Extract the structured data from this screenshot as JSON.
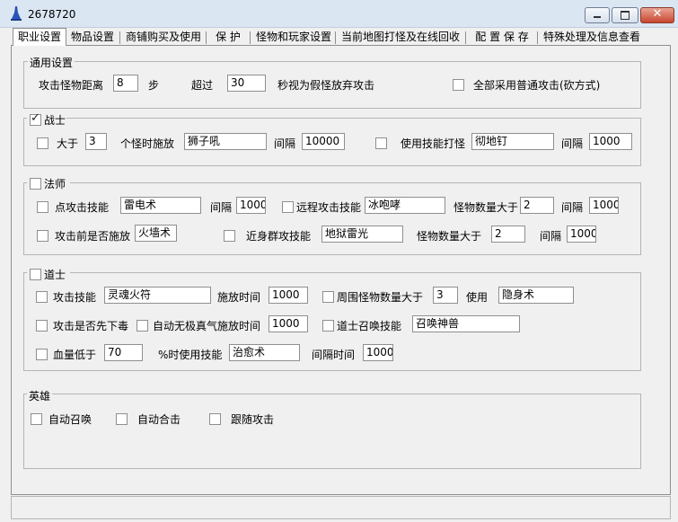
{
  "window": {
    "title": "2678720"
  },
  "tabs": [
    "职业设置",
    "物品设置",
    "商铺购买及使用",
    "保  护",
    "怪物和玩家设置",
    "当前地图打怪及在线回收",
    "配 置 保 存",
    "特殊处理及信息查看"
  ],
  "general": {
    "title": "通用设置",
    "distance_label": "攻击怪物距离",
    "distance_value": "8",
    "step_label": "步",
    "exceed_label": "超过",
    "exceed_value": "30",
    "fake_label": "秒视为假怪放弃攻击",
    "normal_attack_label": "全部采用普通攻击(砍方式)"
  },
  "warrior": {
    "title": "战士",
    "checked": true,
    "gt_label": "大于",
    "gt_value": "3",
    "cast_label": "个怪时施放",
    "skill1": "狮子吼",
    "interval_label": "间隔",
    "interval1": "10000",
    "use_skill_label": "使用技能打怪",
    "skill2": "彻地钉",
    "interval2": "1000"
  },
  "mage": {
    "title": "法师",
    "point_label": "点攻击技能",
    "point_skill": "雷电术",
    "interval_label": "间隔",
    "point_interval": "1000",
    "ranged_label": "远程攻击技能",
    "ranged_skill": "冰咆哮",
    "monster_gt_label": "怪物数量大于",
    "ranged_count": "2",
    "ranged_interval": "1000",
    "pre_cast_label": "攻击前是否施放",
    "pre_cast_skill": "火墙术",
    "melee_label": "近身群攻技能",
    "melee_skill": "地狱雷光",
    "melee_count": "2",
    "melee_interval": "1000"
  },
  "taoist": {
    "title": "道士",
    "attack_label": "攻击技能",
    "attack_skill": "灵魂火符",
    "cast_time_label": "施放时间",
    "attack_time": "1000",
    "around_label": "周围怪物数量大于",
    "around_value": "3",
    "use_label": "使用",
    "around_skill": "隐身术",
    "poison_label": "攻击是否先下毒",
    "auto_label": "自动无极真气施放时间",
    "auto_time": "1000",
    "summon_label": "道士召唤技能",
    "summon_skill": "召唤神兽",
    "hp_label": "血量低于",
    "hp_value": "70",
    "hp_use_label": "%时使用技能",
    "hp_skill": "治愈术",
    "interval_time_label": "间隔时间",
    "hp_interval": "1000"
  },
  "hero": {
    "title": "英雄",
    "auto_summon": "自动召唤",
    "auto_combine": "自动合击",
    "follow_attack": "跟随攻击"
  }
}
